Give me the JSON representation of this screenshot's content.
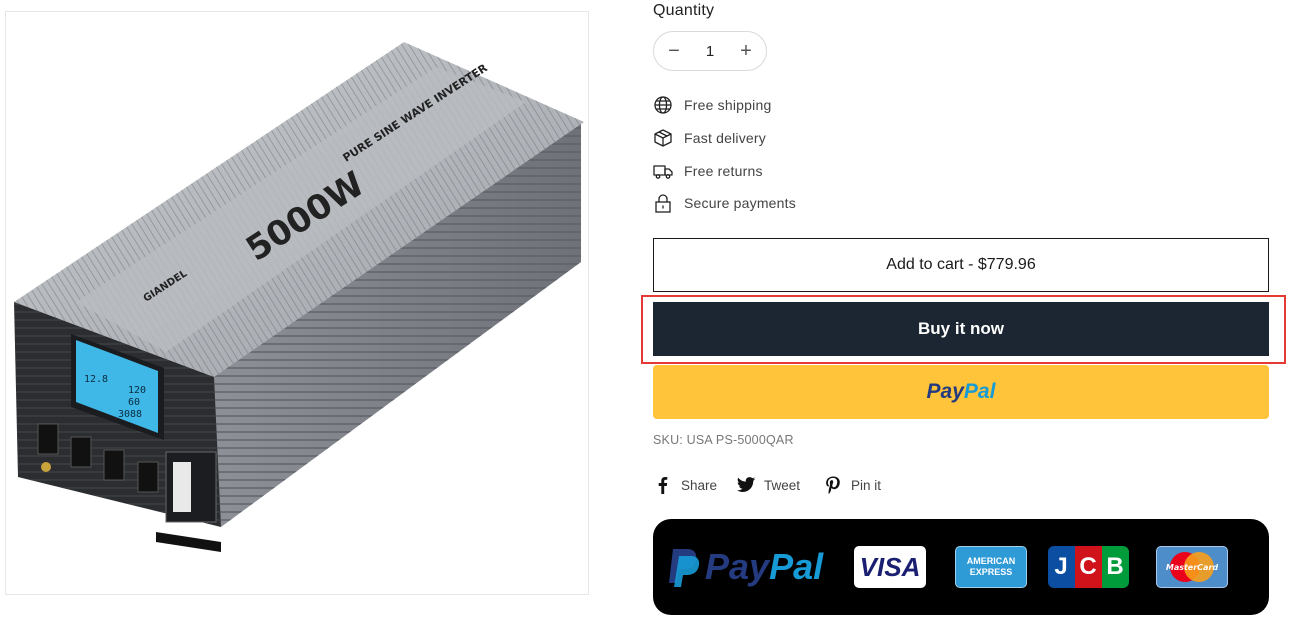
{
  "product_image": {
    "alt_brand": "GIANDEL",
    "model_text": "5000W",
    "subtitle": "PURE SINE WAVE INVERTER",
    "lcd_readouts": [
      "12.8",
      "120",
      "60",
      "3088"
    ]
  },
  "quantity": {
    "label": "Quantity",
    "value": "1",
    "decrement": "−",
    "increment": "+"
  },
  "features": [
    {
      "icon": "globe-icon",
      "label": "Free shipping"
    },
    {
      "icon": "box-icon",
      "label": "Fast delivery"
    },
    {
      "icon": "truck-icon",
      "label": "Free returns"
    },
    {
      "icon": "lock-icon",
      "label": "Secure payments"
    }
  ],
  "buttons": {
    "add_to_cart": "Add to cart - $779.96",
    "buy_now": "Buy it now",
    "paypal_pay": "Pay",
    "paypal_pal": "Pal"
  },
  "sku": "SKU: USA PS-5000QAR",
  "share": [
    {
      "icon": "facebook-icon",
      "label": "Share"
    },
    {
      "icon": "twitter-icon",
      "label": "Tweet"
    },
    {
      "icon": "pinterest-icon",
      "label": "Pin it"
    }
  ],
  "payment_badges": {
    "paypal_pay": "Pay",
    "paypal_pal": "Pal",
    "visa": "VISA",
    "amex_line1": "AMERICAN",
    "amex_line2": "EXPRESS",
    "jcb": [
      "J",
      "C",
      "B"
    ],
    "mastercard": "MasterCard"
  },
  "colors": {
    "buy_now_bg": "#1c2633",
    "paypal_yellow": "#ffc439",
    "highlight_red": "#e53935"
  }
}
